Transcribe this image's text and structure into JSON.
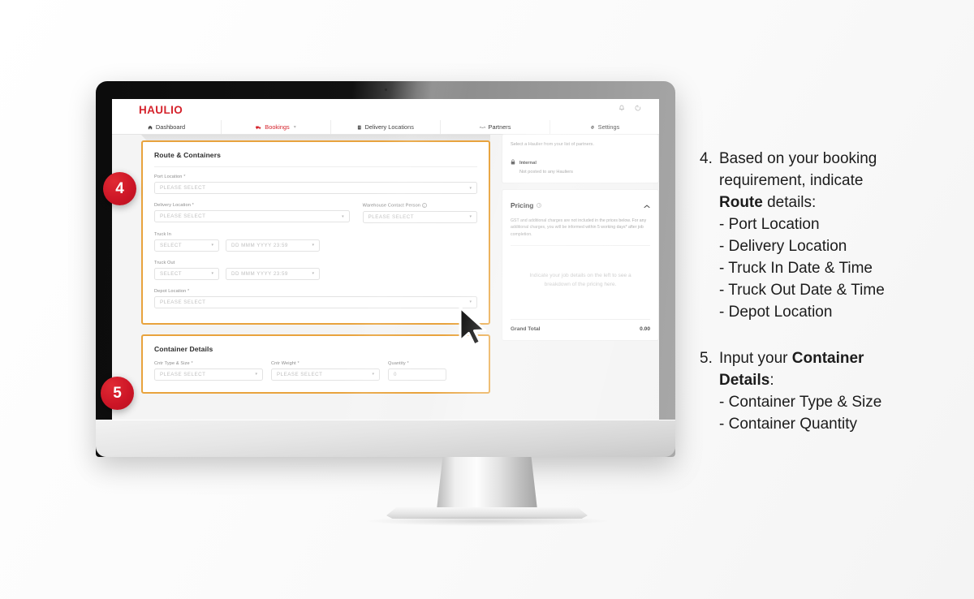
{
  "app": {
    "logo": "HAULIO",
    "topbar_icons": [
      {
        "name": "notification-bell-icon",
        "glyph": "bell"
      },
      {
        "name": "logout-icon",
        "glyph": "power"
      }
    ],
    "nav": [
      {
        "label": "Dashboard",
        "icon": "dashboard-icon",
        "active": false,
        "caret": ""
      },
      {
        "label": "Bookings",
        "icon": "truck-icon",
        "active": true,
        "caret": "▾"
      },
      {
        "label": "Delivery Locations",
        "icon": "warehouse-icon",
        "active": false,
        "caret": ""
      },
      {
        "label": "Partners",
        "icon": "handshake-icon",
        "active": false,
        "caret": ""
      },
      {
        "label": "Settings",
        "icon": "gear-icon",
        "active": false,
        "caret": ""
      }
    ]
  },
  "route_card": {
    "title": "Route & Containers",
    "fields": {
      "port_location": {
        "label": "Port Location",
        "required": "*",
        "placeholder": "PLEASE SELECT"
      },
      "delivery_location": {
        "label": "Delivery Location",
        "required": "*",
        "placeholder": "PLEASE SELECT"
      },
      "warehouse_contact": {
        "label": "Warehouse Contact Person",
        "required": "",
        "placeholder": "PLEASE SELECT"
      },
      "truck_in": {
        "label": "Truck In",
        "select_placeholder": "SELECT",
        "date_placeholder": "DD MMM YYYY 23:59"
      },
      "truck_out": {
        "label": "Truck Out",
        "select_placeholder": "SELECT",
        "date_placeholder": "DD MMM YYYY 23:59"
      },
      "depot_location": {
        "label": "Depot Location",
        "required": "*",
        "placeholder": "PLEASE SELECT"
      }
    }
  },
  "container_card": {
    "title": "Container Details",
    "fields": {
      "type_size": {
        "label": "Cntr Type & Size",
        "required": "*",
        "placeholder": "PLEASE SELECT"
      },
      "weight": {
        "label": "Cntr Weight",
        "required": "*",
        "placeholder": "PLEASE SELECT"
      },
      "quantity": {
        "label": "Quantity",
        "required": "*",
        "placeholder": "0"
      }
    }
  },
  "hauler_panel": {
    "hint": "Select a Haulier from your list of partners.",
    "option_title": "Internal",
    "option_subtitle": "Not posted to any Hauliers"
  },
  "pricing": {
    "title": "Pricing",
    "note": "GST and additional charges are not included in the prices below. For any additional charges, you will be informed within 5 working days* after job completion.",
    "empty_state": "Indicate your job details on the left to see a breakdown of the pricing here.",
    "grand_total_label": "Grand Total",
    "grand_total_value": "0.00"
  },
  "badges": {
    "four": "4",
    "five": "5"
  },
  "annotations": [
    {
      "number": "4.",
      "line1": "Based on your booking",
      "line2": "requirement, indicate",
      "bold": "Route",
      "after_bold": " details:",
      "items": [
        "- Port Location",
        "- Delivery Location",
        "- Truck In Date & Time",
        "- Truck Out Date & Time",
        "- Depot Location"
      ]
    },
    {
      "number": "5.",
      "line1_pre": "Input your ",
      "bold": "Container",
      "line2_bold": "Details",
      "line2_post": ":",
      "items": [
        "- Container Type & Size",
        "- Container Quantity"
      ]
    }
  ],
  "colors": {
    "brand_red": "#d5232c",
    "highlight_orange": "#e8a33d",
    "badge_red": "#cc1526"
  }
}
